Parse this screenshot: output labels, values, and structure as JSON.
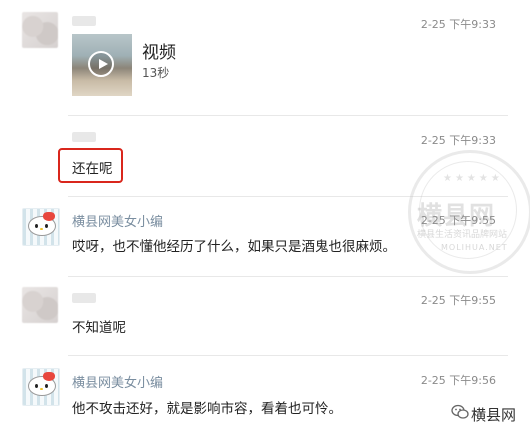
{
  "messages": [
    {
      "time": "2-25 下午9:33",
      "video": {
        "title": "视频",
        "duration": "13秒"
      }
    },
    {
      "time": "2-25 下午9:33",
      "text": "还在呢"
    },
    {
      "sender": "横县网美女小编",
      "time": "2-25 下午9:55",
      "text": "哎呀，也不懂他经历了什么，如果只是酒鬼也很麻烦。"
    },
    {
      "time": "2-25 下午9:55",
      "text": "不知道呢"
    },
    {
      "sender": "横县网美女小编",
      "time": "2-25 下午9:56",
      "text": "他不攻击还好，就是影响市容，看着也可怜。"
    }
  ],
  "watermark": {
    "title": "横县网",
    "subtitle": "横县生活资讯品牌网站",
    "url": "MOLIHUA.NET",
    "stars": "★★★★★"
  },
  "brand": {
    "name": "横县网",
    "icon": "wechat-icon"
  },
  "colors": {
    "highlight": "#d9261c",
    "sender_name": "#7a8ea0",
    "time": "#8a8a8a"
  }
}
